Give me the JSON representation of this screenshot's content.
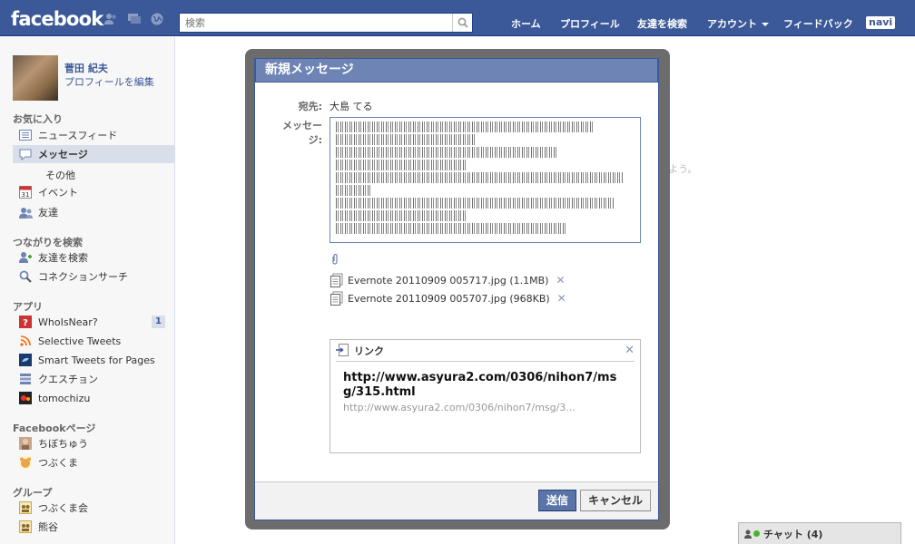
{
  "header": {
    "logo": "facebook",
    "search_placeholder": "検索",
    "nav": [
      "ホーム",
      "プロフィール",
      "友達を検索",
      "アカウント",
      "フィードバック"
    ],
    "navi_badge": "navi"
  },
  "profile": {
    "name": "菅田 紀夫",
    "edit": "プロフィールを編集"
  },
  "sidebar": {
    "favorites_title": "お気に入り",
    "favorites": [
      {
        "label": "ニュースフィード",
        "icon": "news-feed-icon"
      },
      {
        "label": "メッセージ",
        "icon": "messages-icon"
      },
      {
        "label": "イベント",
        "icon": "calendar-icon"
      },
      {
        "label": "友達",
        "icon": "friends-icon"
      }
    ],
    "messages_sub": "その他",
    "connect_title": "つながりを検索",
    "connect": [
      {
        "label": "友達を検索",
        "icon": "find-friends-icon"
      },
      {
        "label": "コネクションサーチ",
        "icon": "magnifier-icon"
      }
    ],
    "apps_title": "アプリ",
    "apps": [
      {
        "label": "WhoIsNear?",
        "icon": "whoisnear-icon",
        "count": "1"
      },
      {
        "label": "Selective Tweets",
        "icon": "rss-icon"
      },
      {
        "label": "Smart Tweets for Pages",
        "icon": "bird-icon"
      },
      {
        "label": "クエスチョン",
        "icon": "questions-icon"
      },
      {
        "label": "tomochizu",
        "icon": "tomochizu-icon"
      }
    ],
    "pages_title": "Facebookページ",
    "pages": [
      {
        "label": "ちぼちゅう",
        "icon": "page-avatar-icon"
      },
      {
        "label": "つぶくま",
        "icon": "bear-avatar-icon"
      }
    ],
    "groups_title": "グループ",
    "groups": [
      {
        "label": "つぶくま会",
        "icon": "group-icon"
      },
      {
        "label": "熊谷",
        "icon": "group-icon"
      }
    ]
  },
  "background_text": "よう。",
  "modal": {
    "title": "新規メッセージ",
    "to_label": "宛先:",
    "to_value": "大島 てる",
    "message_label": "メッセージ:",
    "attachments": [
      {
        "name": "Evernote 20110909 005717.jpg (1.1MB)"
      },
      {
        "name": "Evernote 20110909 005707.jpg (968KB)"
      }
    ],
    "link_header": "リンク",
    "link_title": "http://www.asyura2.com/0306/nihon7/msg/315.html",
    "link_url": "http://www.asyura2.com/0306/nihon7/msg/3...",
    "send": "送信",
    "cancel": "キャンセル"
  },
  "chat": {
    "label": "チャット (4)"
  }
}
